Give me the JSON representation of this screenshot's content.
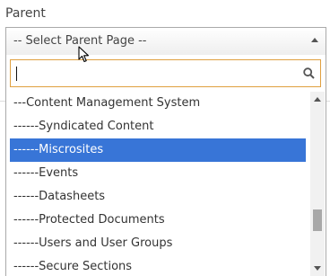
{
  "field": {
    "label": "Parent"
  },
  "select": {
    "selected_value": "-- Select Parent Page --"
  },
  "search": {
    "value": "",
    "icon": "search-icon"
  },
  "options": [
    {
      "label": "---Content Management System",
      "selected": false
    },
    {
      "label": "------Syndicated Content",
      "selected": false
    },
    {
      "label": "------Miscrosites",
      "selected": true
    },
    {
      "label": "------Events",
      "selected": false
    },
    {
      "label": "------Datasheets",
      "selected": false
    },
    {
      "label": "------Protected Documents",
      "selected": false
    },
    {
      "label": "------Users and User Groups",
      "selected": false
    },
    {
      "label": "------Secure Sections",
      "selected": false
    }
  ],
  "colors": {
    "highlight": "#3875d7",
    "focus_border": "#e0a040",
    "border": "#aaaaaa"
  }
}
